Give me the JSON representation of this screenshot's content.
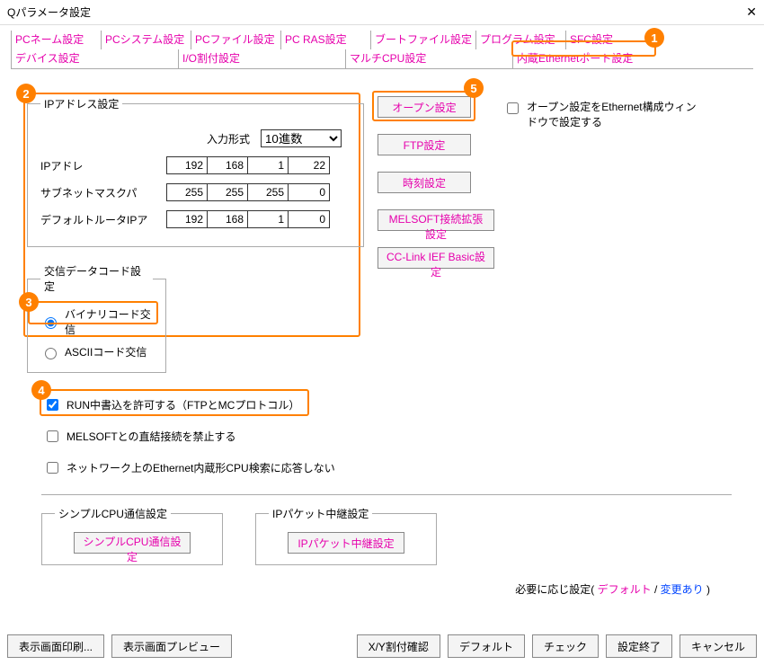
{
  "window": {
    "title": "Qパラメータ設定",
    "close": "✕"
  },
  "tabs1": [
    "PCネーム設定",
    "PCシステム設定",
    "PCファイル設定",
    "PC RAS設定",
    "ブートファイル設定",
    "プログラム設定",
    "SFC設定"
  ],
  "tabs2": [
    "デバイス設定",
    "I/O割付設定",
    "マルチCPU設定",
    "内蔵Ethernetポート設定"
  ],
  "ip": {
    "legend": "IPアドレス設定",
    "fmt_label": "入力形式",
    "fmt_value": "10進数",
    "ipaddr_label": "IPアドレ",
    "ipaddr": [
      "192",
      "168",
      "1",
      "22"
    ],
    "subnet_label": "サブネットマスクパ",
    "subnet": [
      "255",
      "255",
      "255",
      "0"
    ],
    "gw_label": "デフォルトルータIPア",
    "gw": [
      "192",
      "168",
      "1",
      "0"
    ]
  },
  "side": {
    "open": "オープン設定",
    "ftp": "FTP設定",
    "time": "時刻設定",
    "melsoft": "MELSOFT接続拡張設定",
    "cclink": "CC-Link IEF Basic設定"
  },
  "open_check": "オープン設定をEthernet構成ウィンドウで設定する",
  "code": {
    "legend": "交信データコード設定",
    "binary": "バイナリコード交信",
    "ascii": "ASCIIコード交信"
  },
  "checks": {
    "run": "RUN中書込を許可する（FTPとMCプロトコル）",
    "melsoft": "MELSOFTとの直結接続を禁止する",
    "net": "ネットワーク上のEthernet内蔵形CPU検索に応答しない"
  },
  "simple": {
    "legend": "シンプルCPU通信設定",
    "btn": "シンプルCPU通信設定"
  },
  "relay": {
    "legend": "IPパケット中継設定",
    "btn": "IPパケット中継設定"
  },
  "need": {
    "prefix": "必要に応じ設定(",
    "default": "デフォルト",
    "sep": " / ",
    "changed": "変更あり",
    "suffix": " )"
  },
  "bottom": {
    "print": "表示画面印刷...",
    "preview": "表示画面プレビュー",
    "xy": "X/Y割付確認",
    "default": "デフォルト",
    "check": "チェック",
    "finish": "設定終了",
    "cancel": "キャンセル"
  }
}
